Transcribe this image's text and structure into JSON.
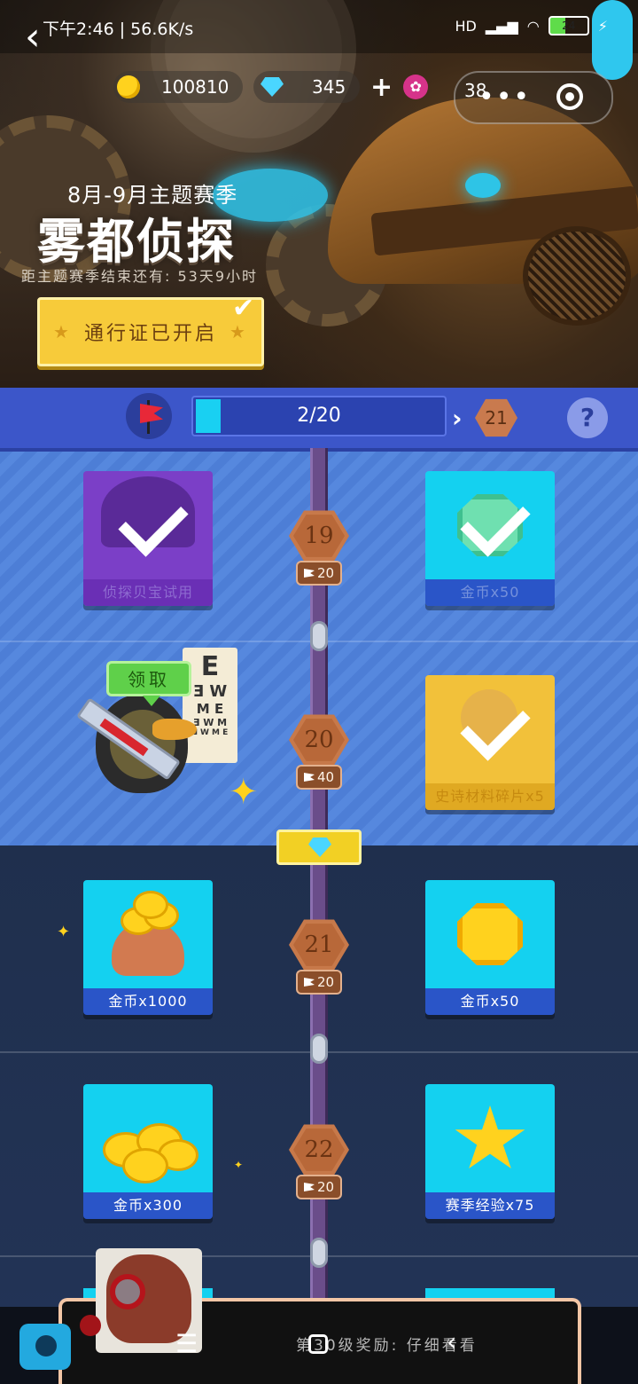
{
  "status_bar": {
    "time_speed": "下午2:46 | 56.6K/s",
    "signal": "HD",
    "battery": "24"
  },
  "currency": {
    "coins": "100810",
    "gems": "345",
    "tickets": "38"
  },
  "season": {
    "subtitle": "8月-9月主题赛季",
    "title": "雾都侦探",
    "remaining": "距主题赛季结束还有: 53天9小时",
    "pass_button": "通行证已开启"
  },
  "progress": {
    "text": "2/20",
    "fraction": 0.1,
    "next_level": "21"
  },
  "levels": [
    {
      "level": "19",
      "req": "20",
      "left_label": "侦探贝宝试用",
      "right_label": "金币x50",
      "claimed": true
    },
    {
      "level": "20",
      "req": "40",
      "left_label": "",
      "right_label": "史诗材料碎片x5",
      "claimed": true
    },
    {
      "level": "21",
      "req": "20",
      "left_label": "金币x1000",
      "right_label": "金币x50",
      "claimed": false
    },
    {
      "level": "22",
      "req": "20",
      "left_label": "金币x300",
      "right_label": "赛季经验x75",
      "claimed": false
    }
  ],
  "claim_button": "领取",
  "eye_chart": [
    "E",
    "Ǝ W",
    "M E",
    "Ǝ W M",
    "Ǝ W M E"
  ],
  "bottom": {
    "next_reward_text": "第30级奖励: 仔细看看"
  },
  "icons": {
    "back": "back-arrow-icon",
    "coin": "coin-icon",
    "gem": "gem-icon",
    "lotus": "lotus-icon",
    "menu": "more-dots-icon",
    "target": "target-icon",
    "help": "question-icon"
  },
  "colors": {
    "progress_bg": "#3c56c9",
    "progress_fill": "#19d0f2",
    "claimed_row": "#4d7ed6",
    "open_row": "#1f2f4d",
    "level_hex": "#c7794a",
    "pass_button": "#f7cb3a"
  }
}
